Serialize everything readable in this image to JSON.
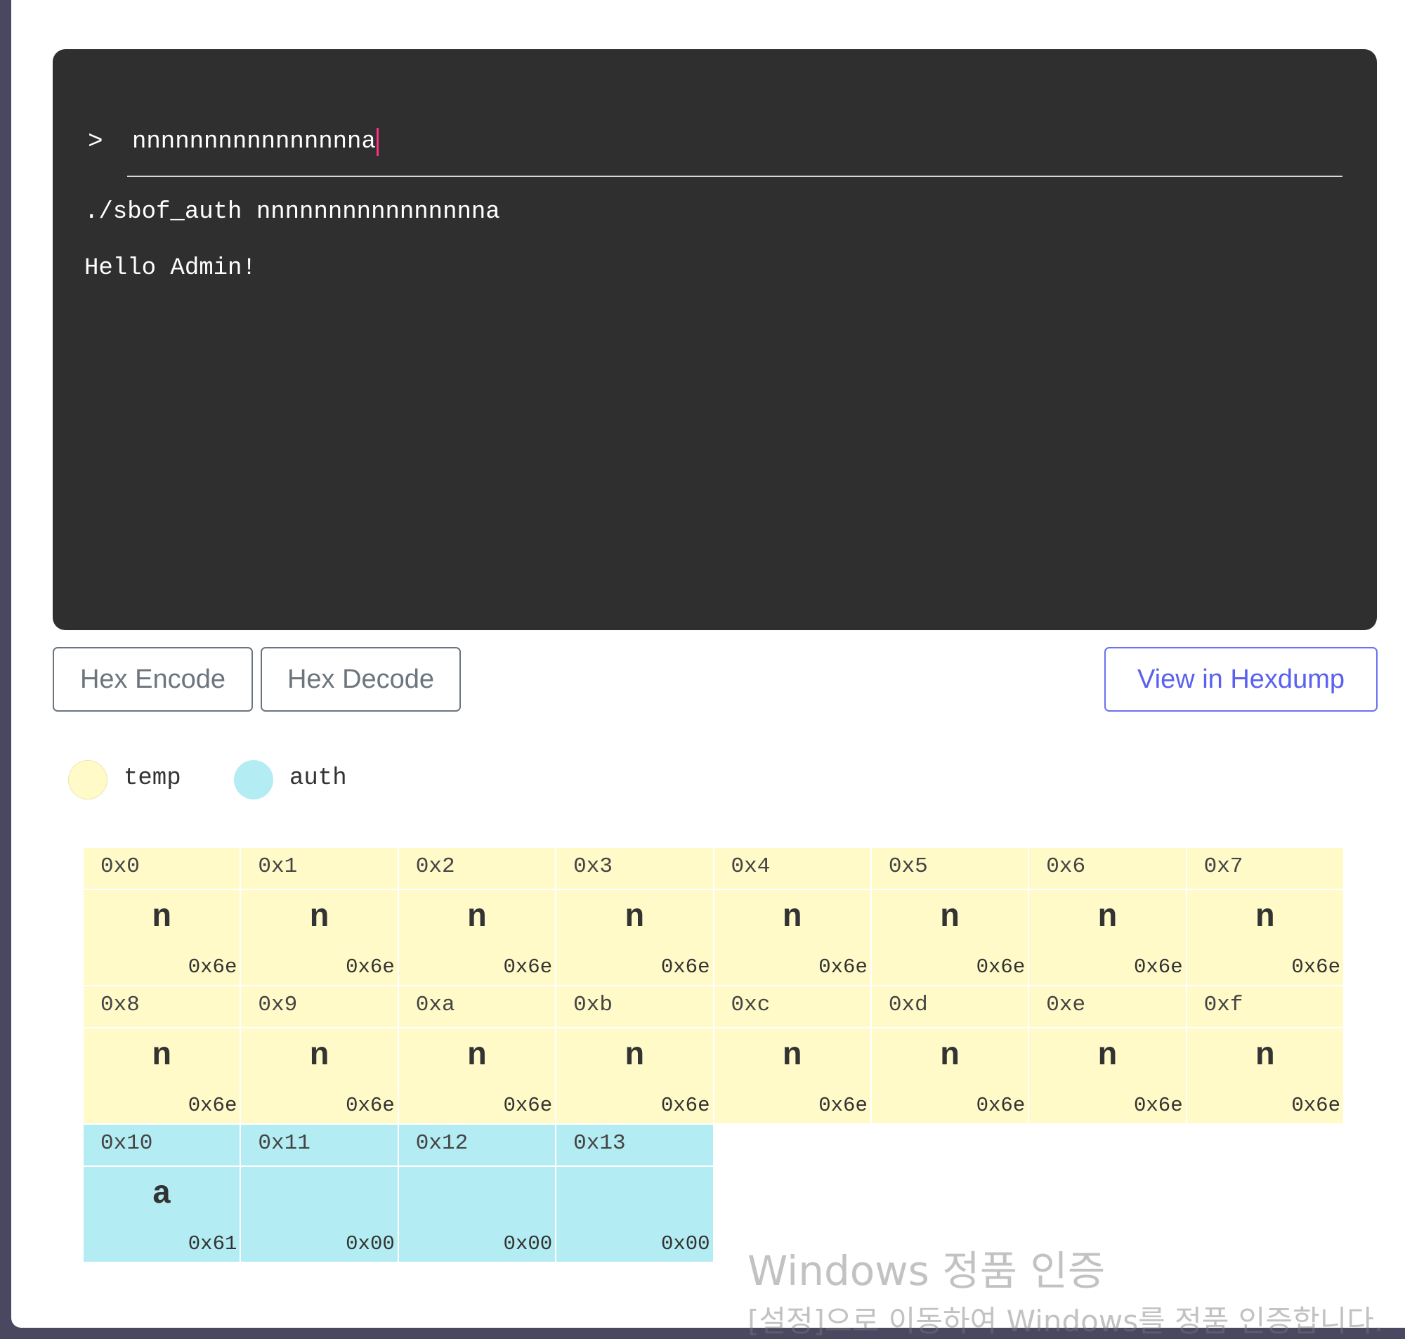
{
  "terminal": {
    "prompt_symbol": ">",
    "input_value": "nnnnnnnnnnnnnnnna",
    "command_line": "./sbof_auth nnnnnnnnnnnnnnnna",
    "output_line": "Hello Admin!"
  },
  "buttons": {
    "hex_encode": "Hex Encode",
    "hex_decode": "Hex Decode",
    "view_hexdump": "View in Hexdump"
  },
  "legend": {
    "temp": "temp",
    "auth": "auth"
  },
  "colors": {
    "terminal_bg": "#2f2f2f",
    "cursor": "#ff2e7e",
    "temp": "#fffac8",
    "auth": "#b3ecf2",
    "primary_outline": "#6b70f2"
  },
  "memory": {
    "rows": [
      [
        {
          "addr": "0x0",
          "char": "n",
          "hex": "0x6e",
          "region": "temp"
        },
        {
          "addr": "0x1",
          "char": "n",
          "hex": "0x6e",
          "region": "temp"
        },
        {
          "addr": "0x2",
          "char": "n",
          "hex": "0x6e",
          "region": "temp"
        },
        {
          "addr": "0x3",
          "char": "n",
          "hex": "0x6e",
          "region": "temp"
        },
        {
          "addr": "0x4",
          "char": "n",
          "hex": "0x6e",
          "region": "temp"
        },
        {
          "addr": "0x5",
          "char": "n",
          "hex": "0x6e",
          "region": "temp"
        },
        {
          "addr": "0x6",
          "char": "n",
          "hex": "0x6e",
          "region": "temp"
        },
        {
          "addr": "0x7",
          "char": "n",
          "hex": "0x6e",
          "region": "temp"
        }
      ],
      [
        {
          "addr": "0x8",
          "char": "n",
          "hex": "0x6e",
          "region": "temp"
        },
        {
          "addr": "0x9",
          "char": "n",
          "hex": "0x6e",
          "region": "temp"
        },
        {
          "addr": "0xa",
          "char": "n",
          "hex": "0x6e",
          "region": "temp"
        },
        {
          "addr": "0xb",
          "char": "n",
          "hex": "0x6e",
          "region": "temp"
        },
        {
          "addr": "0xc",
          "char": "n",
          "hex": "0x6e",
          "region": "temp"
        },
        {
          "addr": "0xd",
          "char": "n",
          "hex": "0x6e",
          "region": "temp"
        },
        {
          "addr": "0xe",
          "char": "n",
          "hex": "0x6e",
          "region": "temp"
        },
        {
          "addr": "0xf",
          "char": "n",
          "hex": "0x6e",
          "region": "temp"
        }
      ],
      [
        {
          "addr": "0x10",
          "char": "a",
          "hex": "0x61",
          "region": "auth"
        },
        {
          "addr": "0x11",
          "char": "",
          "hex": "0x00",
          "region": "auth"
        },
        {
          "addr": "0x12",
          "char": "",
          "hex": "0x00",
          "region": "auth"
        },
        {
          "addr": "0x13",
          "char": "",
          "hex": "0x00",
          "region": "auth"
        }
      ]
    ]
  },
  "watermark": {
    "title": "Windows 정품 인증",
    "subtitle": "[설정]으로 이동하여 Windows를 정품 인증합니다."
  }
}
